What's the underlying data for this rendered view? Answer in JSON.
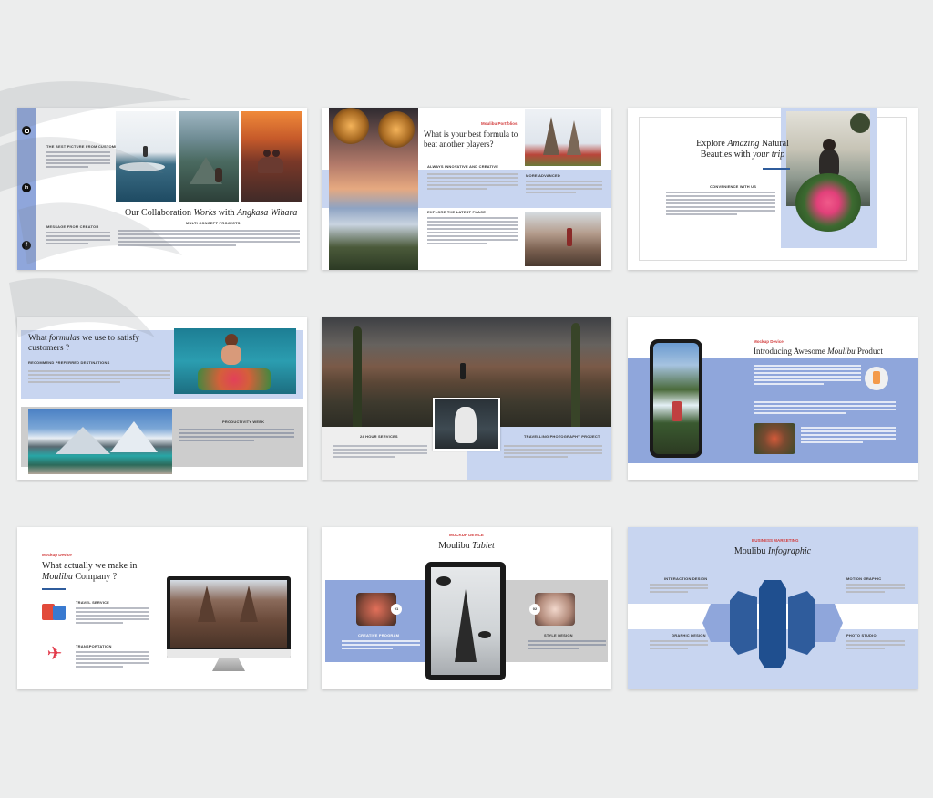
{
  "colors": {
    "background": "#eceded",
    "accent_blue": "#8fa6db",
    "pale_blue": "#c8d5f0",
    "accent_red": "#d23c3c",
    "dark_blue": "#2f5c9c",
    "gray_panel": "#cdcdcd"
  },
  "slide1": {
    "title_pre": "Our Collaboration ",
    "title_em": "Works",
    "title_mid": " with ",
    "title_em2": "Angkasa Wihara",
    "subtitle": "MULTI CONCEPT PROJECTS",
    "label_top": "THE BEST PICTURE FROM CUSTOMER",
    "label_bottom": "MESSAGE FROM CREATOR",
    "icons": [
      "instagram-icon",
      "linkedin-icon",
      "facebook-icon"
    ]
  },
  "slide2": {
    "tag": "Moulibu Portfolios",
    "title": "What is your best formula to beat another players?",
    "h1": "ALWAYS INNOVATIVE AND CREATIVE",
    "h2": "MORE ADVANCED",
    "h3": "EXPLORE THE LATEST PLACE"
  },
  "slide3": {
    "title_pre": "Explore ",
    "title_em": "Amazing",
    "title_mid": " Natural Beauties with ",
    "title_em2": "your trip",
    "label": "CONVENIENCE WITH US"
  },
  "slide4": {
    "title_pre": "What ",
    "title_em": "formulas",
    "title_post": " we use to satisfy customers ?",
    "label1": "RECOMMEND PREFERRED DESTINATIONS",
    "label2": "PRODUCTIVITY WEEK"
  },
  "slide5": {
    "label1": "24 HOUR SERVICES",
    "label2": "TRAVELLING PHOTOGRAPHY PROJECT"
  },
  "slide6": {
    "tag": "Mockup Device",
    "title_pre": "Introducing Awesome ",
    "title_em": "Moulibu",
    "title_post": " Product"
  },
  "slide7": {
    "tag": "Mockup Device",
    "title_pre": "What actually we make in ",
    "title_em": "Moulibu",
    "title_post": " Company ?",
    "item1": "TRAVEL SERVICE",
    "item2": "TRANSPORTATION"
  },
  "slide8": {
    "tag": "MOCKUP DEVICE",
    "title_pre": "Moulibu ",
    "title_em": "Tablet",
    "label1": "CREATIVE PROGRAM",
    "label2": "STYLE DESIGN",
    "badge1": "01",
    "badge2": "02"
  },
  "slide9": {
    "tag": "BUSINESS MARKETING",
    "title_pre": "Moulibu ",
    "title_em": "Infographic",
    "label1": "INTERACTION DESIGN",
    "label2": "MOTION GRAPHIC",
    "label3": "GRAPHIC DESIGN",
    "label4": "PHOTO STUDIO"
  }
}
